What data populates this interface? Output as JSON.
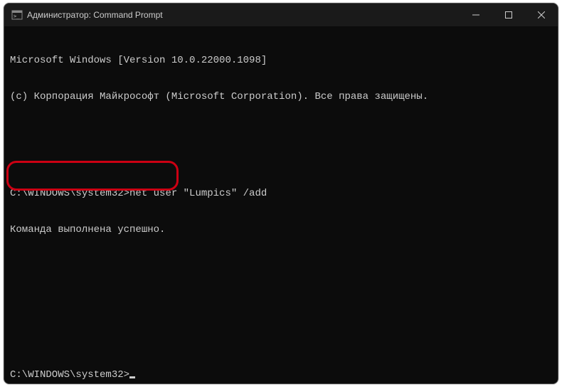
{
  "window": {
    "title": "Администратор: Command Prompt"
  },
  "terminal": {
    "line1": "Microsoft Windows [Version 10.0.22000.1098]",
    "line2": "(c) Корпорация Майкрософт (Microsoft Corporation). Все права защищены.",
    "prompt1_path": "C:\\WINDOWS\\system32>",
    "prompt1_command": "net user \"Lumpics\" /add",
    "result_line": "Команда выполнена успешно.",
    "prompt2_path": "C:\\WINDOWS\\system32>"
  }
}
